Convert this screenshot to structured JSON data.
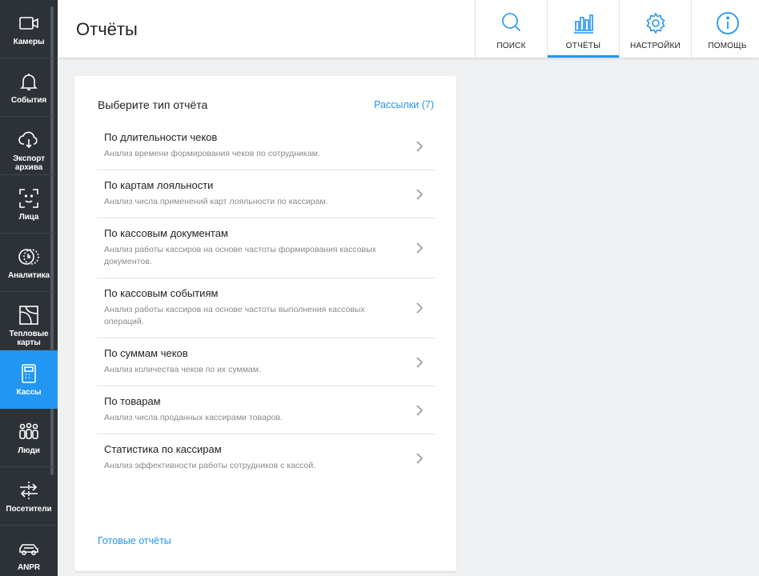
{
  "sidebar": {
    "items": [
      {
        "label": "Камеры",
        "icon": "camera-icon"
      },
      {
        "label": "События",
        "icon": "bell-icon"
      },
      {
        "label": "Экспорт архива",
        "icon": "cloud-download-icon"
      },
      {
        "label": "Лица",
        "icon": "face-icon"
      },
      {
        "label": "Аналитика",
        "icon": "analytics-icon"
      },
      {
        "label": "Тепловые карты",
        "icon": "heatmap-icon"
      },
      {
        "label": "Кассы",
        "icon": "cash-register-icon",
        "active": true
      },
      {
        "label": "Люди",
        "icon": "people-icon"
      },
      {
        "label": "Посетители",
        "icon": "visitors-icon"
      },
      {
        "label": "ANPR",
        "icon": "car-icon"
      }
    ]
  },
  "header": {
    "title": "Отчёты",
    "tabs": [
      {
        "label": "ПОИСК",
        "icon": "search-icon"
      },
      {
        "label": "ОТЧЁТЫ",
        "icon": "bar-chart-icon",
        "active": true
      },
      {
        "label": "НАСТРОЙКИ",
        "icon": "gear-icon"
      },
      {
        "label": "ПОМОЩЬ",
        "icon": "info-icon"
      }
    ]
  },
  "card": {
    "title": "Выберите тип отчёта",
    "subscriptions_label": "Рассылки (7)",
    "ready_reports_label": "Готовые отчёты",
    "reports": [
      {
        "name": "По длительности чеков",
        "desc": "Анализ времени формирования чеков по сотрудникам."
      },
      {
        "name": "По картам лояльности",
        "desc": "Анализ числа применений карт лояльности по кассирам."
      },
      {
        "name": "По кассовым документам",
        "desc": "Анализ работы кассиров на основе частоты формирования кассовых документов."
      },
      {
        "name": "По кассовым событиям",
        "desc": "Анализ работы кассиров на основе частоты выполнения кассовых операций."
      },
      {
        "name": "По суммам чеков",
        "desc": "Анализ количества чеков по их суммам."
      },
      {
        "name": "По товарам",
        "desc": "Анализ числа проданных кассирами товаров."
      },
      {
        "name": "Статистика по кассирам",
        "desc": "Анализ эффективности работы сотрудников с кассой."
      }
    ]
  },
  "colors": {
    "accent": "#2196f3",
    "sidebar_bg": "#2c3238",
    "page_bg": "#f0f1f3"
  }
}
